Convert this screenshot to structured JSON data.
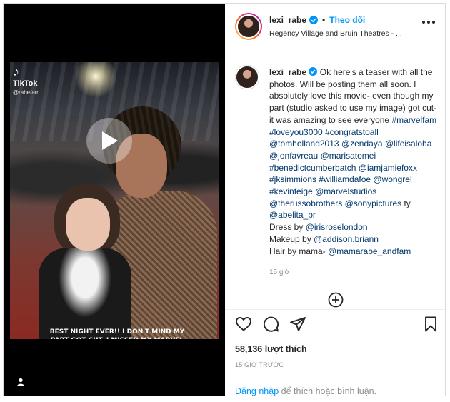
{
  "media": {
    "tiktok_brand": "TikTok",
    "tiktok_handle": "@rabefam",
    "caption": "BEST NIGHT EVER!! I DON'T MIND MY PART GOT CUT. I MISSED MY MARVEL FAM. THIS MOVIE WAS AMAZING. HOPE TO START FILMING AGAIN SOON!😊"
  },
  "header": {
    "username": "lexi_rabe",
    "separator": "•",
    "follow_label": "Theo dõi",
    "location": "Regency Village and Bruin Theatres - ..."
  },
  "post": {
    "username": "lexi_rabe",
    "text_intro": "Ok here's a teaser with all the photos. Will be posting them all soon. I absolutely love this movie- even though my part (studio asked to use my image) got cut- it was amazing to see everyone",
    "line_tags_1": [
      "#marvelfam",
      "#loveyou3000",
      "#congratstoall",
      "@tomholland2013",
      "@zendaya",
      "@lifeisaloha",
      "@jonfavreau",
      "@marisatomei",
      "#benedictcumberbatch",
      "@iamjamiefoxx",
      "#jksimmions",
      "#williamdafoe",
      "@wongrel",
      "#kevinfeige",
      "@marvelstudios",
      "@therussobrothers",
      "@sonypictures"
    ],
    "ty_text": "ty",
    "ty_link": "@abelita_pr",
    "dress_text": "Dress by",
    "dress_link": "@irisroselondon",
    "makeup_text": "Makeup by",
    "makeup_link": "@addison.briann",
    "hair_text": "Hair by mama-",
    "hair_link": "@mamarabe_andfam",
    "time": "15 giờ"
  },
  "actions": {
    "likes": "58,136 lượt thích",
    "ago": "15 GIỜ TRƯỚC",
    "login_link": "Đăng nhập",
    "login_text": "để thích hoặc bình luận."
  },
  "colors": {
    "link": "#00376b",
    "accent": "#0095f6",
    "muted": "#8e8e8e"
  }
}
